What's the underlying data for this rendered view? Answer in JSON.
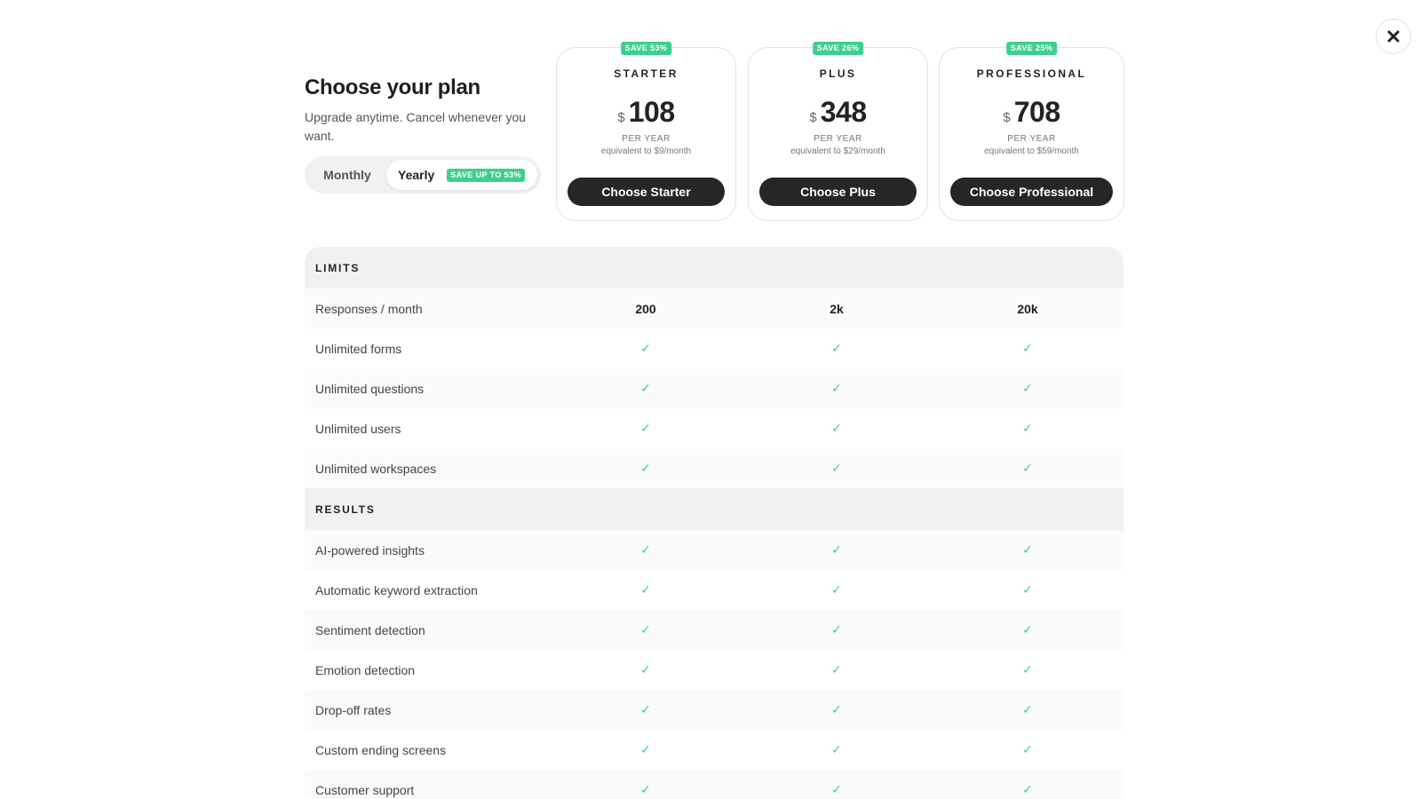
{
  "intro": {
    "title": "Choose your plan",
    "subtitle": "Upgrade anytime. Cancel whenever you want."
  },
  "billing": {
    "monthly_label": "Monthly",
    "yearly_label": "Yearly",
    "yearly_badge": "SAVE UP TO 53%",
    "selected": "Yearly"
  },
  "plans": [
    {
      "badge": "SAVE 53%",
      "name": "STARTER",
      "currency": "$",
      "price": "108",
      "period": "PER YEAR",
      "equivalent": "equivalent to $9/month",
      "button": "Choose Starter"
    },
    {
      "badge": "SAVE 26%",
      "name": "PLUS",
      "currency": "$",
      "price": "348",
      "period": "PER YEAR",
      "equivalent": "equivalent to $29/month",
      "button": "Choose Plus"
    },
    {
      "badge": "SAVE 25%",
      "name": "PROFESSIONAL",
      "currency": "$",
      "price": "708",
      "period": "PER YEAR",
      "equivalent": "equivalent to $59/month",
      "button": "Choose Professional"
    }
  ],
  "features": {
    "limits": {
      "heading": "LIMITS",
      "rows": [
        {
          "label": "Responses / month",
          "values": [
            "200",
            "2k",
            "20k"
          ]
        },
        {
          "label": "Unlimited forms",
          "values": [
            "✓",
            "✓",
            "✓"
          ]
        },
        {
          "label": "Unlimited questions",
          "values": [
            "✓",
            "✓",
            "✓"
          ]
        },
        {
          "label": "Unlimited users",
          "values": [
            "✓",
            "✓",
            "✓"
          ]
        },
        {
          "label": "Unlimited workspaces",
          "values": [
            "✓",
            "✓",
            "✓"
          ]
        }
      ]
    },
    "results": {
      "heading": "RESULTS",
      "rows": [
        {
          "label": "AI-powered insights",
          "values": [
            "✓",
            "✓",
            "✓"
          ]
        },
        {
          "label": "Automatic keyword extraction",
          "values": [
            "✓",
            "✓",
            "✓"
          ]
        },
        {
          "label": "Sentiment detection",
          "values": [
            "✓",
            "✓",
            "✓"
          ]
        },
        {
          "label": "Emotion detection",
          "values": [
            "✓",
            "✓",
            "✓"
          ]
        },
        {
          "label": "Drop-off rates",
          "values": [
            "✓",
            "✓",
            "✓"
          ]
        },
        {
          "label": "Custom ending screens",
          "values": [
            "✓",
            "✓",
            "✓"
          ]
        },
        {
          "label": "Customer support",
          "values": [
            "✓",
            "✓",
            "✓"
          ]
        }
      ]
    }
  },
  "colors": {
    "accent_green": "#3ecf8e",
    "button_dark": "#262626",
    "section_bg": "#f1f1f3"
  },
  "icons": {
    "close": "close-icon",
    "check": "check-icon"
  }
}
